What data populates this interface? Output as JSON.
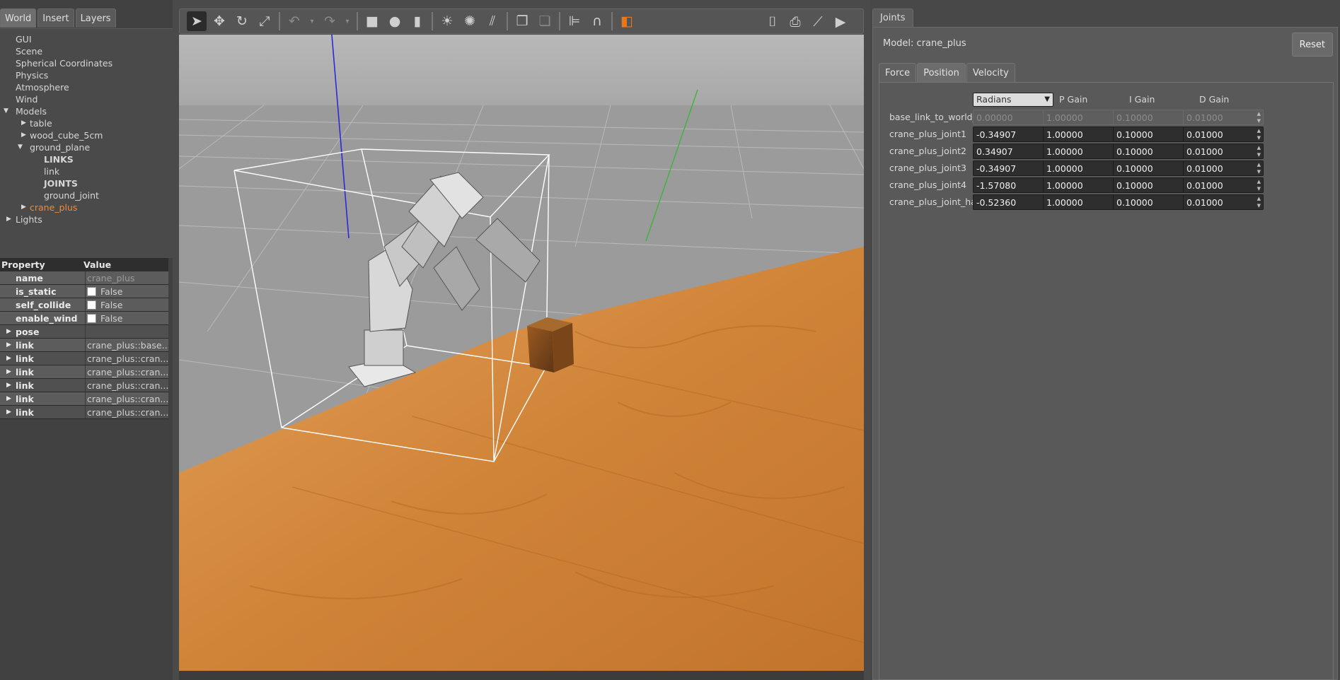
{
  "left_tabs": [
    "World",
    "Insert",
    "Layers"
  ],
  "tree": {
    "top_items": [
      "GUI",
      "Scene",
      "Spherical Coordinates",
      "Physics",
      "Atmosphere",
      "Wind"
    ],
    "models_label": "Models",
    "models": [
      "table",
      "wood_cube_5cm",
      "ground_plane"
    ],
    "ground_plane_children": [
      "LINKS",
      "link",
      "JOINTS",
      "ground_joint"
    ],
    "selected_model": "crane_plus",
    "lights_label": "Lights"
  },
  "properties": {
    "header": [
      "Property",
      "Value"
    ],
    "name_key": "name",
    "name_value": "crane_plus",
    "is_static_key": "is_static",
    "is_static_value": "False",
    "self_collide_key": "self_collide",
    "self_collide_value": "False",
    "enable_wind_key": "enable_wind",
    "enable_wind_value": "False",
    "pose_key": "pose",
    "links": [
      {
        "key": "link",
        "value": "crane_plus::base..."
      },
      {
        "key": "link",
        "value": "crane_plus::cran..."
      },
      {
        "key": "link",
        "value": "crane_plus::cran..."
      },
      {
        "key": "link",
        "value": "crane_plus::cran..."
      },
      {
        "key": "link",
        "value": "crane_plus::cran..."
      },
      {
        "key": "link",
        "value": "crane_plus::cran..."
      }
    ]
  },
  "toolbar": {
    "icons": [
      "select-arrow-icon",
      "translate-icon",
      "rotate-icon",
      "scale-icon",
      "undo-icon",
      "redo-icon",
      "box-icon",
      "sphere-icon",
      "cylinder-icon",
      "point-light-icon",
      "spot-light-icon",
      "directional-light-icon",
      "copy-icon",
      "paste-icon",
      "align-icon",
      "snap-icon",
      "view-angle-icon",
      "screenshot-icon",
      "log-icon",
      "plot-icon",
      "record-video-icon"
    ]
  },
  "joints_panel": {
    "tab_label": "Joints",
    "model_label": "Model: crane_plus",
    "reset_label": "Reset",
    "sub_tabs": [
      "Force",
      "Position",
      "Velocity"
    ],
    "active_sub_tab": "Position",
    "units": "Radians",
    "columns": [
      "P Gain",
      "I Gain",
      "D Gain"
    ],
    "rows": [
      {
        "name": "base_link_to_world_joint",
        "target": "0.00000",
        "p": "1.00000",
        "i": "0.10000",
        "d": "0.01000",
        "disabled": true
      },
      {
        "name": "crane_plus_joint1",
        "target": "-0.34907",
        "p": "1.00000",
        "i": "0.10000",
        "d": "0.01000",
        "disabled": false
      },
      {
        "name": "crane_plus_joint2",
        "target": "0.34907",
        "p": "1.00000",
        "i": "0.10000",
        "d": "0.01000",
        "disabled": false
      },
      {
        "name": "crane_plus_joint3",
        "target": "-0.34907",
        "p": "1.00000",
        "i": "0.10000",
        "d": "0.01000",
        "disabled": false
      },
      {
        "name": "crane_plus_joint4",
        "target": "-1.57080",
        "p": "1.00000",
        "i": "0.10000",
        "d": "0.01000",
        "disabled": false
      },
      {
        "name": "crane_plus_joint_hand",
        "target": "-0.52360",
        "p": "1.00000",
        "i": "0.10000",
        "d": "0.01000",
        "disabled": false
      }
    ]
  },
  "colors": {
    "selected_model": "#f0893a",
    "floor": "#d2853a",
    "sky": "#b3b3b3"
  }
}
